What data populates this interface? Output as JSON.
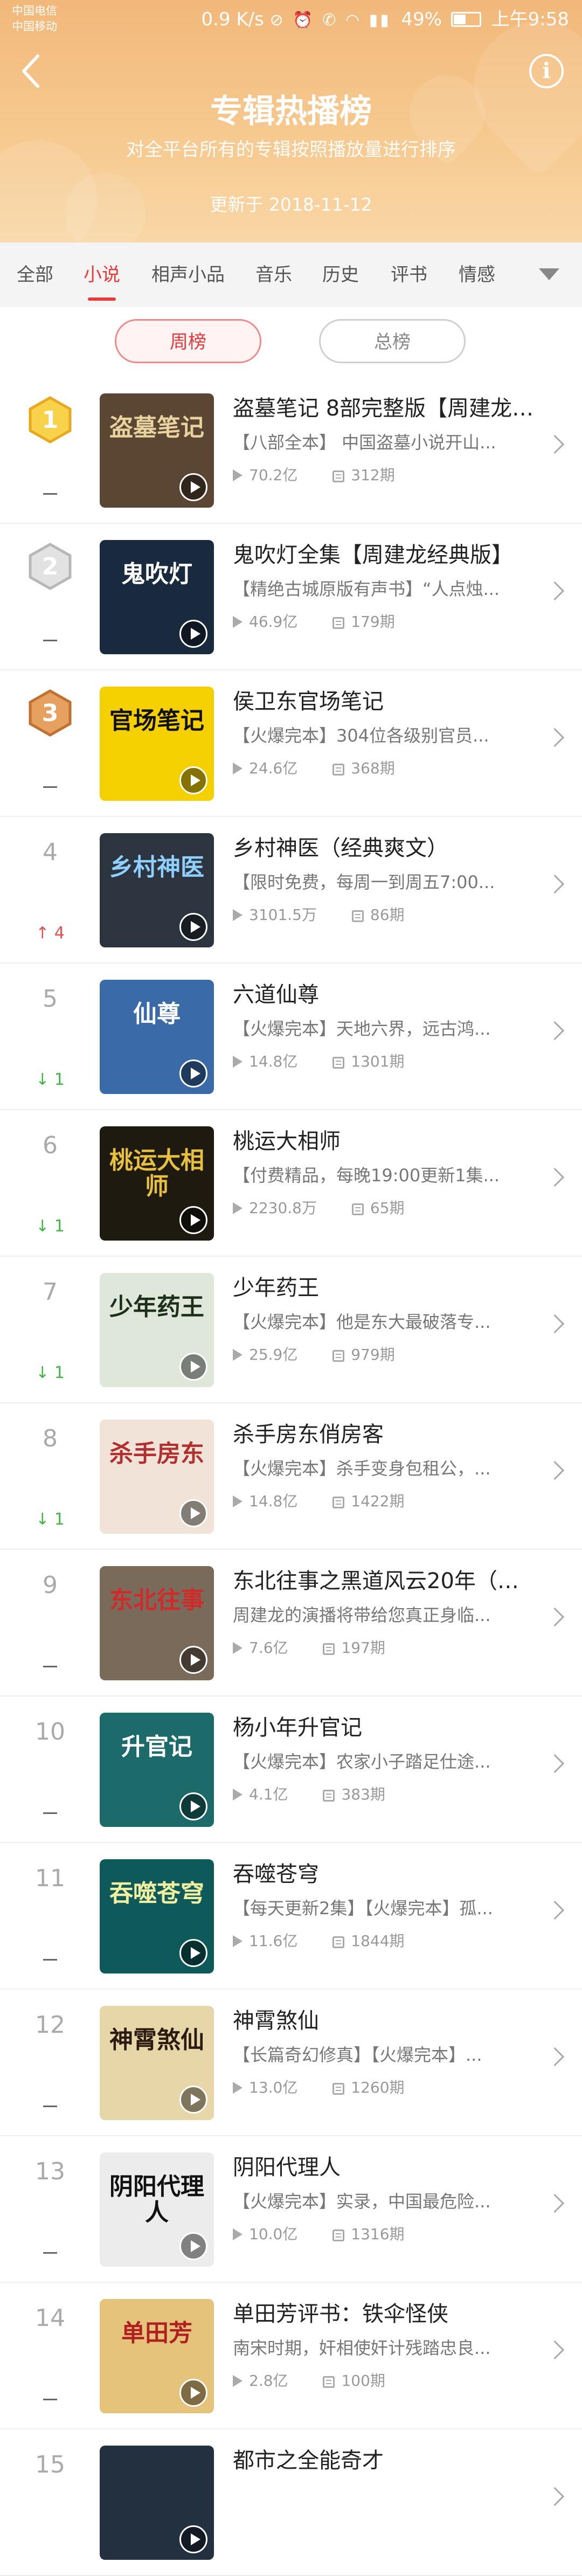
{
  "status_bar": {
    "carrier_1": "中国电信",
    "carrier_2": "中国移动",
    "speed": "0.9 K/s",
    "battery": "49%",
    "time": "上午9:58"
  },
  "header": {
    "title": "专辑热播榜",
    "subtitle": "对全平台所有的专辑按照播放量进行排序",
    "updated": "更新于 2018-11-12",
    "info_glyph": "i",
    "gradient_colors": [
      "#f2b87a",
      "#f9d7a6"
    ]
  },
  "tabs": {
    "items": [
      "全部",
      "小说",
      "相声小品",
      "音乐",
      "历史",
      "评书",
      "情感"
    ],
    "active": "小说",
    "accent": "#e83a3a"
  },
  "toggle": {
    "weekly": "周榜",
    "total": "总榜",
    "selected": "周榜"
  },
  "list": [
    {
      "rank": "1",
      "medal": "gold",
      "change": "—",
      "change_dir": "none",
      "title": "盗墓笔记 8部完整版【周建龙演...",
      "desc": "【八部全本】 中国盗墓小说开山...",
      "plays": "70.2亿",
      "episodes": "312期",
      "cover_text": "盗墓笔记",
      "cover_bg": "#5a4632",
      "cover_fg": "#e8d2a0"
    },
    {
      "rank": "2",
      "medal": "silver",
      "change": "—",
      "change_dir": "none",
      "title": "鬼吹灯全集【周建龙经典版】",
      "desc": "【精绝古城原版有声书】“人点烛...",
      "plays": "46.9亿",
      "episodes": "179期",
      "cover_text": "鬼吹灯",
      "cover_bg": "#1a2a3e",
      "cover_fg": "#ffffff"
    },
    {
      "rank": "3",
      "medal": "bronze",
      "change": "—",
      "change_dir": "none",
      "title": "侯卫东官场笔记",
      "desc": "【火爆完本】304位各级别官员...",
      "plays": "24.6亿",
      "episodes": "368期",
      "cover_text": "官场笔记",
      "cover_bg": "#f5d000",
      "cover_fg": "#111111"
    },
    {
      "rank": "4",
      "medal": "",
      "change": "4",
      "change_dir": "up",
      "title": "乡村神医（经典爽文）",
      "desc": "【限时免费，每周一到周五7:00...",
      "plays": "3101.5万",
      "episodes": "86期",
      "cover_text": "乡村神医",
      "cover_bg": "#2c3440",
      "cover_fg": "#8fd0ff"
    },
    {
      "rank": "5",
      "medal": "",
      "change": "1",
      "change_dir": "down",
      "title": "六道仙尊",
      "desc": "【火爆完本】天地六界，远古鸿...",
      "plays": "14.8亿",
      "episodes": "1301期",
      "cover_text": "仙尊",
      "cover_bg": "#3a6aa8",
      "cover_fg": "#ffffff"
    },
    {
      "rank": "6",
      "medal": "",
      "change": "1",
      "change_dir": "down",
      "title": "桃运大相师",
      "desc": "【付费精品，每晚19:00更新1集...",
      "plays": "2230.8万",
      "episodes": "65期",
      "cover_text": "桃运大相师",
      "cover_bg": "#1e1a10",
      "cover_fg": "#e8c040"
    },
    {
      "rank": "7",
      "medal": "",
      "change": "1",
      "change_dir": "down",
      "title": "少年药王",
      "desc": "【火爆完本】他是东大最破落专...",
      "plays": "25.9亿",
      "episodes": "979期",
      "cover_text": "少年药王",
      "cover_bg": "#dfe6da",
      "cover_fg": "#1c2e1c"
    },
    {
      "rank": "8",
      "medal": "",
      "change": "1",
      "change_dir": "down",
      "title": "杀手房东俏房客",
      "desc": "【火爆完本】杀手变身包租公，...",
      "plays": "14.8亿",
      "episodes": "1422期",
      "cover_text": "杀手房东",
      "cover_bg": "#f1e3d8",
      "cover_fg": "#b03030"
    },
    {
      "rank": "9",
      "medal": "",
      "change": "—",
      "change_dir": "none",
      "title": "东北往事之黑道风云20年（全五...",
      "desc": "周建龙的演播将带给您真正身临...",
      "plays": "7.6亿",
      "episodes": "197期",
      "cover_text": "东北往事",
      "cover_bg": "#7a6a5a",
      "cover_fg": "#d02a2a"
    },
    {
      "rank": "10",
      "medal": "",
      "change": "—",
      "change_dir": "none",
      "title": "杨小年升官记",
      "desc": "【火爆完本】农家小子踏足仕途...",
      "plays": "4.1亿",
      "episodes": "383期",
      "cover_text": "升官记",
      "cover_bg": "#1c6a6a",
      "cover_fg": "#ffffff"
    },
    {
      "rank": "11",
      "medal": "",
      "change": "—",
      "change_dir": "none",
      "title": "吞噬苍穹",
      "desc": "【每天更新2集】【火爆完本】孤...",
      "plays": "11.6亿",
      "episodes": "1844期",
      "cover_text": "吞噬苍穹",
      "cover_bg": "#0e5a5a",
      "cover_fg": "#f0f0a0"
    },
    {
      "rank": "12",
      "medal": "",
      "change": "—",
      "change_dir": "none",
      "title": "神霄煞仙",
      "desc": "【长篇奇幻修真】【火爆完本】...",
      "plays": "13.0亿",
      "episodes": "1260期",
      "cover_text": "神霄煞仙",
      "cover_bg": "#e7d6a8",
      "cover_fg": "#2a1a10"
    },
    {
      "rank": "13",
      "medal": "",
      "change": "—",
      "change_dir": "none",
      "title": "阴阳代理人",
      "desc": "【火爆完本】实录，中国最危险...",
      "plays": "10.0亿",
      "episodes": "1316期",
      "cover_text": "阴阳代理人",
      "cover_bg": "#ececec",
      "cover_fg": "#111111"
    },
    {
      "rank": "14",
      "medal": "",
      "change": "—",
      "change_dir": "none",
      "title": "单田芳评书：铁伞怪侠",
      "desc": "南宋时期，奸相使奸计残踏忠良...",
      "plays": "2.8亿",
      "episodes": "100期",
      "cover_text": "单田芳",
      "cover_bg": "#e6c37a",
      "cover_fg": "#b02020"
    },
    {
      "rank": "15",
      "medal": "",
      "change": "",
      "change_dir": "none",
      "title": "都市之全能奇才",
      "desc": "",
      "plays": "",
      "episodes": "",
      "cover_text": "",
      "cover_bg": "#233040",
      "cover_fg": "#ffffff"
    }
  ]
}
